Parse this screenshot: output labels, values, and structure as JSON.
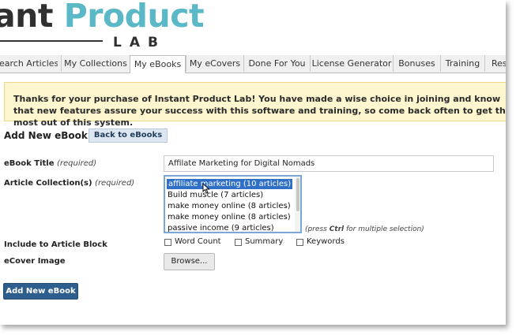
{
  "header": {
    "logo_part1": "ant ",
    "logo_part2": "Product",
    "logo_lab": "LAB"
  },
  "nav": {
    "tabs": [
      {
        "label": "Search Articles"
      },
      {
        "label": "My Collections"
      },
      {
        "label": "My eBooks",
        "active": true
      },
      {
        "label": "My eCovers"
      },
      {
        "label": "Done For You"
      },
      {
        "label": "License Generator"
      },
      {
        "label": "Bonuses"
      },
      {
        "label": "Training"
      },
      {
        "label": "Res"
      }
    ]
  },
  "banner": {
    "text": "Thanks for your purchase of Instant Product Lab! You have made a wise choice in joining and know that new features assure your success with this software and training, so come back often to get the most out of this system."
  },
  "page": {
    "heading": "Add New eBook",
    "back_button": "Back to eBooks"
  },
  "form": {
    "title_label": "eBook Title",
    "title_required": "(required)",
    "title_value": "Affilate Marketing for Digital Nomads",
    "collections_label": "Article Collection(s)",
    "collections_required": "(required)",
    "collections": [
      {
        "label": "affiliate marketing (10 articles)",
        "selected": true
      },
      {
        "label": "Build muscle (7 articles)"
      },
      {
        "label": "make money online (8 articles)"
      },
      {
        "label": "make money online (8 articles)"
      },
      {
        "label": "passive income (9 articles)"
      }
    ],
    "hint_pre": "(press ",
    "hint_key": "Ctrl",
    "hint_post": " for multiple selection)",
    "include_label": "Include to Article Block",
    "checkboxes": [
      {
        "label": "Word Count",
        "checked": false
      },
      {
        "label": "Summary",
        "checked": false
      },
      {
        "label": "Keywords",
        "checked": false
      }
    ],
    "ecover_label": "eCover Image",
    "browse_button": "Browse...",
    "submit_button": "Add New eBook"
  },
  "colors": {
    "brand_teal": "#5bb8c6",
    "banner_bg": "#fdf6cf",
    "primary_button": "#2e5e8e",
    "selection": "#2f6fc5"
  }
}
